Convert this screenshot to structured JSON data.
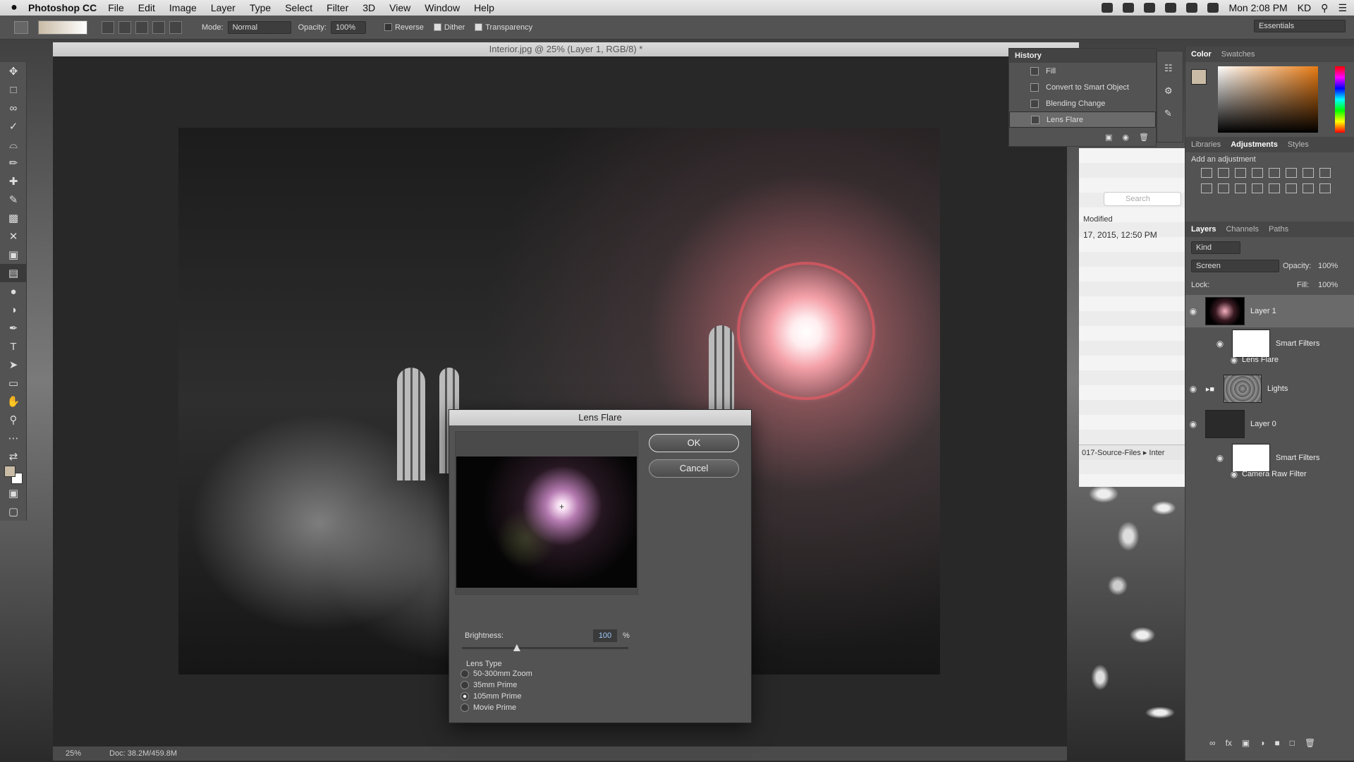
{
  "menubar": {
    "apple": "",
    "app_name": "Photoshop CC",
    "items": [
      "File",
      "Edit",
      "Image",
      "Layer",
      "Type",
      "Select",
      "Filter",
      "3D",
      "View",
      "Window",
      "Help"
    ],
    "clock": "Mon 2:08 PM",
    "user": "KD"
  },
  "options": {
    "mode_label": "Mode:",
    "mode_value": "Normal",
    "opacity_label": "Opacity:",
    "opacity_value": "100%",
    "reverse": "Reverse",
    "dither": "Dither",
    "transparency": "Transparency",
    "workspace": "Essentials"
  },
  "document": {
    "title": "Interior.jpg @ 25% (Layer 1, RGB/8) *",
    "zoom": "25%",
    "doc_size": "Doc: 38.2M/459.8M"
  },
  "history": {
    "title": "History",
    "items": [
      "Fill",
      "Convert to Smart Object",
      "Blending Change",
      "Lens Flare"
    ],
    "selected": "Lens Flare"
  },
  "finder": {
    "search": "Search",
    "column": "Modified",
    "date": "17, 2015, 12:50 PM",
    "path_a": "017-Source-Files",
    "path_b": "Inter"
  },
  "color_panel": {
    "tabs": [
      "Color",
      "Swatches"
    ],
    "active": "Color",
    "foreground": "#c9bba5",
    "background": "#ffffff"
  },
  "adjust_panel": {
    "tabs": [
      "Libraries",
      "Adjustments",
      "Styles"
    ],
    "active": "Adjustments",
    "hint": "Add an adjustment"
  },
  "layers_panel": {
    "tabs": [
      "Layers",
      "Channels",
      "Paths"
    ],
    "active": "Layers",
    "filter": "Kind",
    "blend_mode": "Screen",
    "opacity_label": "Opacity:",
    "opacity": "100%",
    "lock_label": "Lock:",
    "fill_label": "Fill:",
    "fill": "100%",
    "layers": [
      {
        "name": "Layer 1"
      },
      {
        "name": "Smart Filters"
      },
      {
        "name": "Lens Flare"
      },
      {
        "name": "Lights"
      },
      {
        "name": "Layer 0"
      },
      {
        "name": "Smart Filters"
      },
      {
        "name": "Camera Raw Filter"
      }
    ]
  },
  "dialog": {
    "title": "Lens Flare",
    "ok": "OK",
    "cancel": "Cancel",
    "brightness_label": "Brightness:",
    "brightness_value": "100",
    "brightness_unit": "%",
    "brightness_level": 0.33,
    "lens_type_label": "Lens Type",
    "lens_types": [
      "50-300mm Zoom",
      "35mm Prime",
      "105mm Prime",
      "Movie Prime"
    ],
    "selected_lens": "105mm Prime"
  }
}
